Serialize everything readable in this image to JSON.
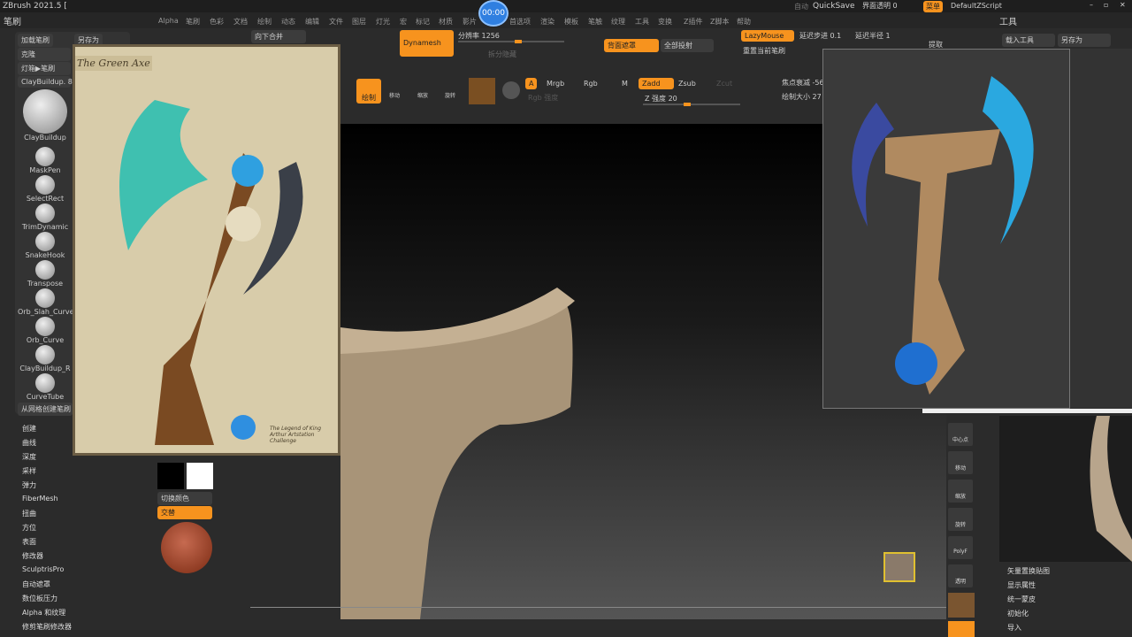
{
  "app": {
    "title": "ZBrush 2021.5 [",
    "timer": "00:00"
  },
  "titlebar": {
    "autosave": "自动",
    "quicksave": "QuickSave",
    "ui_transparency": "界面透明 0",
    "menu": "菜单",
    "script": "DefaultZScript"
  },
  "menus": [
    "Alpha",
    "笔刷",
    "色彩",
    "文档",
    "绘制",
    "动态",
    "编辑",
    "文件",
    "图层",
    "灯光",
    "宏",
    "标记",
    "材质",
    "影片",
    "首选项",
    "渲染",
    "模板",
    "笔触",
    "纹理",
    "工具",
    "变换",
    "Z插件",
    "Z脚本",
    "帮助"
  ],
  "left_panel": {
    "title": "笔刷",
    "load": "加载笔刷",
    "save_as": "另存为",
    "clone": "克隆",
    "lightbox": "灯箱▶笔刷",
    "current": "ClayBuildup. 8",
    "brushes": [
      "ClayBuildup",
      "MaskPen",
      "SelectRect",
      "TrimDynamic",
      "SnakeHook",
      "Transpose",
      "Orb_Slah_Curve",
      "Orb_Curve",
      "ClayBuildup_R",
      "CurveTube"
    ],
    "create_from_mesh": "从网格创建笔刷",
    "sections": [
      "创建",
      "曲线",
      "深度",
      "采样",
      "弹力",
      "FiberMesh",
      "扭曲",
      "方位",
      "表面",
      "修改器",
      "SculptrisPro",
      "自动遮罩",
      "数位板压力",
      "Alpha 和纹理",
      "修剪笔刷修改器"
    ]
  },
  "toolbar": {
    "merge_down": "向下合并",
    "dynamesh": "Dynamesh",
    "resolution": "分辨率 1256",
    "split_hidden": "拆分隐藏",
    "backface_mask": "背面遮罩",
    "project_all": "全部投射",
    "lazymouse": "LazyMouse",
    "lazy_step": "延迟步进 0.1",
    "lazy_radius": "延迟半径 1",
    "reset_brush": "重置当前笔刷",
    "extract": "提取",
    "draw": "绘制",
    "move": "移动",
    "scale": "缩放",
    "rotate": "旋转",
    "a": "A",
    "mrgb": "Mrgb",
    "rgb": "Rgb",
    "m": "M",
    "rgb_intensity": "Rgb 强度",
    "zadd": "Zadd",
    "zsub": "Zsub",
    "zcut": "Zcut",
    "z_intensity": "Z 强度 20",
    "focal_shift": "焦点衰减 -56",
    "draw_size": "绘制大小 27"
  },
  "color": {
    "switch": "切换颜色",
    "alternate": "交替"
  },
  "reference": {
    "title": "The Green Axe",
    "caption": "The Legend of King Arthur Artstation Challenge"
  },
  "right_panel": {
    "title": "工具",
    "load_tool": "载入工具",
    "save_as": "另存为",
    "icons": [
      "中心点",
      "移动",
      "缩放",
      "旋转",
      "PolyF",
      "透明"
    ],
    "items": [
      "矢量置换贴图",
      "显示属性",
      "统一蒙皮",
      "初始化",
      "导入"
    ]
  },
  "colors": {
    "accent": "#f7931e",
    "panel": "#2b2b2b"
  }
}
